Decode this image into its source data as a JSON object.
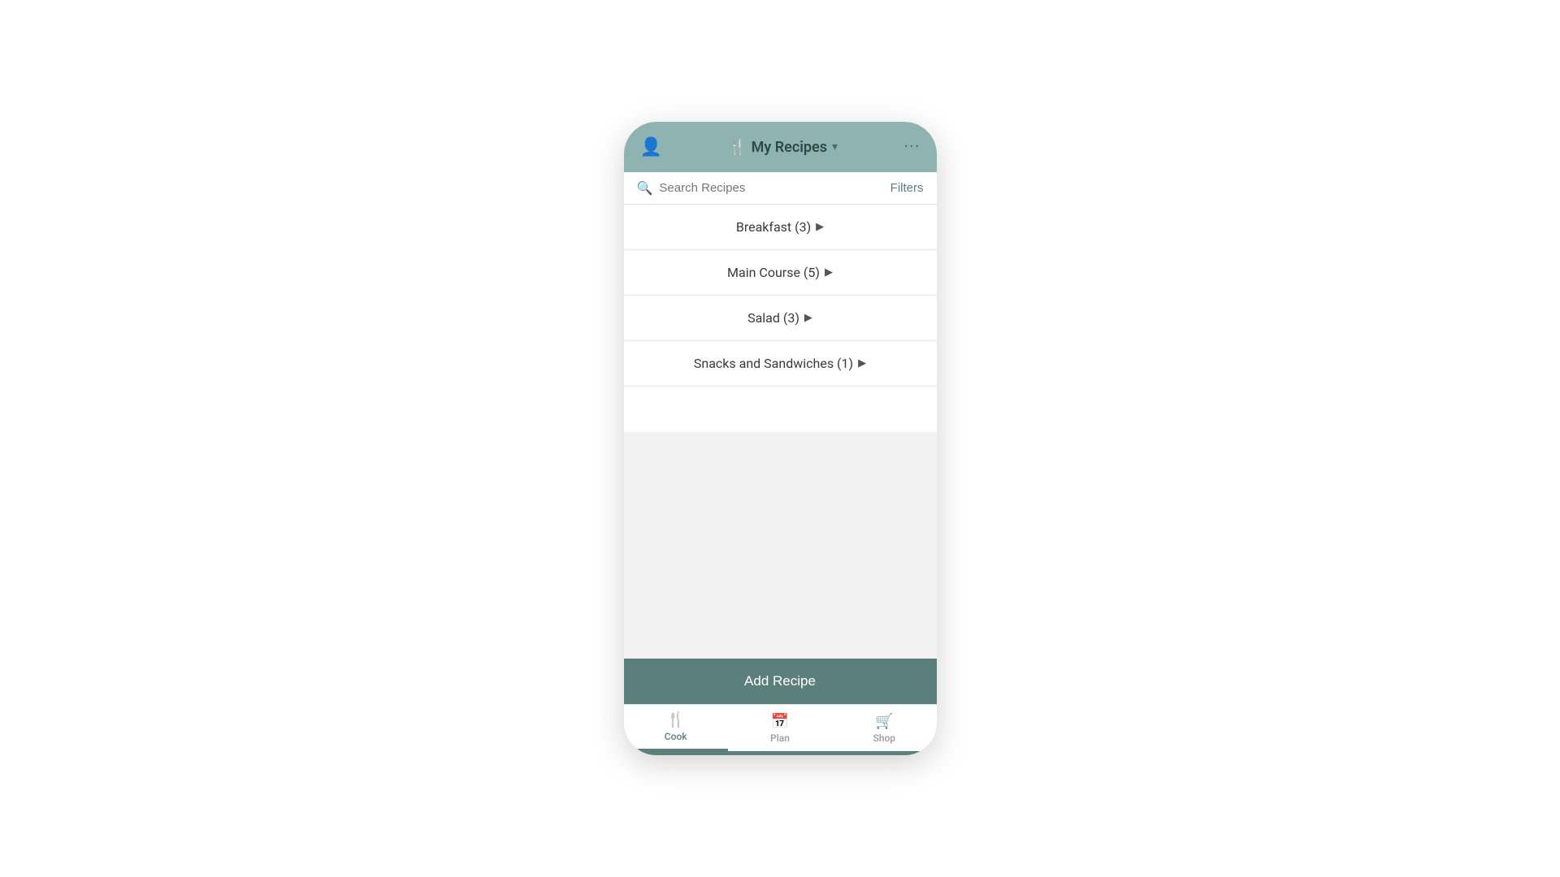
{
  "header": {
    "title": "My Recipes",
    "user_icon": "👤",
    "fork_icon": "🍴",
    "chevron": "▾",
    "more_icon": "···"
  },
  "search": {
    "placeholder": "Search Recipes",
    "filters_label": "Filters"
  },
  "categories": [
    {
      "label": "Breakfast (3)",
      "chevron": "▶"
    },
    {
      "label": "Main Course (5)",
      "chevron": "▶"
    },
    {
      "label": "Salad (3)",
      "chevron": "▶"
    },
    {
      "label": "Snacks and Sandwiches (1)",
      "chevron": "▶"
    }
  ],
  "add_recipe_button": "Add Recipe",
  "tabs": [
    {
      "id": "cook",
      "label": "Cook",
      "icon": "🍴",
      "active": true
    },
    {
      "id": "plan",
      "label": "Plan",
      "icon": "📅",
      "active": false
    },
    {
      "id": "shop",
      "label": "Shop",
      "icon": "🛒",
      "active": false
    }
  ]
}
